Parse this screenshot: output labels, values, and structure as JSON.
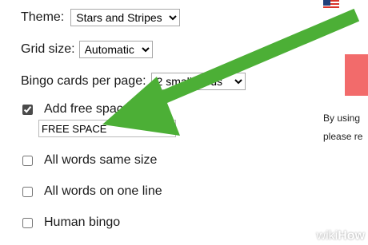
{
  "settings": {
    "theme": {
      "label": "Theme:",
      "selected": "Stars and Stripes"
    },
    "grid_size": {
      "label": "Grid size:",
      "selected": "Automatic"
    },
    "cards_per_page": {
      "label": "Bingo cards per page:",
      "selected": "2 small cards"
    },
    "free_space": {
      "label": "Add free space",
      "checked": true,
      "value": "FREE SPACE"
    },
    "same_size": {
      "label": "All words same size",
      "checked": false
    },
    "one_line": {
      "label": "All words on one line",
      "checked": false
    },
    "human_bingo": {
      "label": "Human bingo",
      "checked": false
    }
  },
  "side_panel": {
    "line1": "By using",
    "line2": "please re"
  },
  "colors": {
    "arrow": "#4caf36",
    "accent_red": "#f26b6b"
  },
  "watermark": {
    "prefix": "wiki",
    "suffix": "How"
  }
}
